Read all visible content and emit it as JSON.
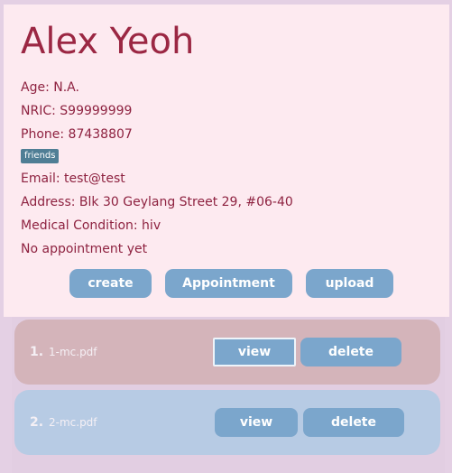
{
  "person": {
    "name": "Alex Yeoh",
    "age": "Age: N.A.",
    "nric": "NRIC: S99999999",
    "phone": "Phone: 87438807",
    "tags": [
      "friends"
    ],
    "email": "Email: test@test",
    "address": "Address: Blk 30 Geylang Street 29, #06-40",
    "medical": "Medical Condition: hiv",
    "appointment": "No appointment yet"
  },
  "actions": {
    "create": "create",
    "appointment": "Appointment",
    "upload": "upload"
  },
  "files": [
    {
      "index": "1.",
      "name": "1-mc.pdf",
      "view": "view",
      "delete": "delete"
    },
    {
      "index": "2.",
      "name": "2-mc.pdf",
      "view": "view",
      "delete": "delete"
    }
  ],
  "colors": {
    "name_text": "#9b2743",
    "button": "#7ba6cc",
    "tag": "#4f7e95",
    "card1": "#d4b4ba",
    "card2": "#b7cbe4"
  }
}
